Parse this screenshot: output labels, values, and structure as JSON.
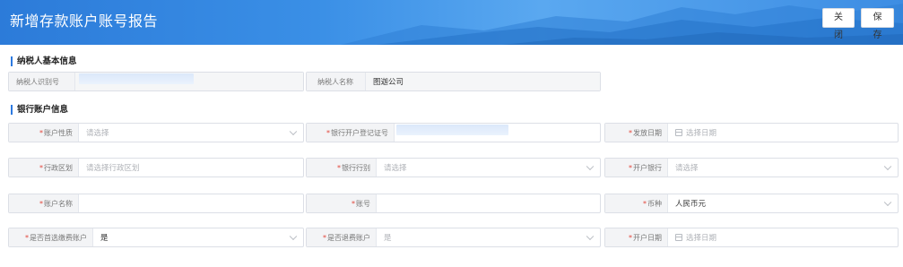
{
  "header": {
    "title": "新增存款账户账号报告",
    "close_label": "关闭",
    "save_label": "保存"
  },
  "sections": {
    "basic": "纳税人基本信息",
    "bank": "银行账户信息"
  },
  "basic_fields": {
    "tin_label": "纳税人识别号",
    "name_label": "纳税人名称",
    "name_value": "图迦公司"
  },
  "bank_fields": {
    "account_type_label": "账户性质",
    "account_type_placeholder": "请选择",
    "license_label": "银行开户登记证号",
    "issue_date_label": "发放日期",
    "issue_date_placeholder": "选择日期",
    "region_label": "行政区划",
    "region_placeholder": "请选择行政区划",
    "bank_category_label": "银行行别",
    "bank_category_placeholder": "请选择",
    "bank_label": "开户银行",
    "bank_placeholder": "请选择",
    "account_name_label": "账户名称",
    "account_no_label": "账号",
    "currency_label": "币种",
    "currency_value": "人民币元",
    "primary_tax_label": "是否首选缴费账户",
    "primary_tax_value": "是",
    "refund_label": "是否退费账户",
    "refund_value": "是",
    "open_date_label": "开户日期",
    "open_date_placeholder": "选择日期"
  },
  "colors": {
    "header_blue": "#3a8fe6",
    "accent": "#2d7ae0",
    "required": "#e2463b"
  }
}
